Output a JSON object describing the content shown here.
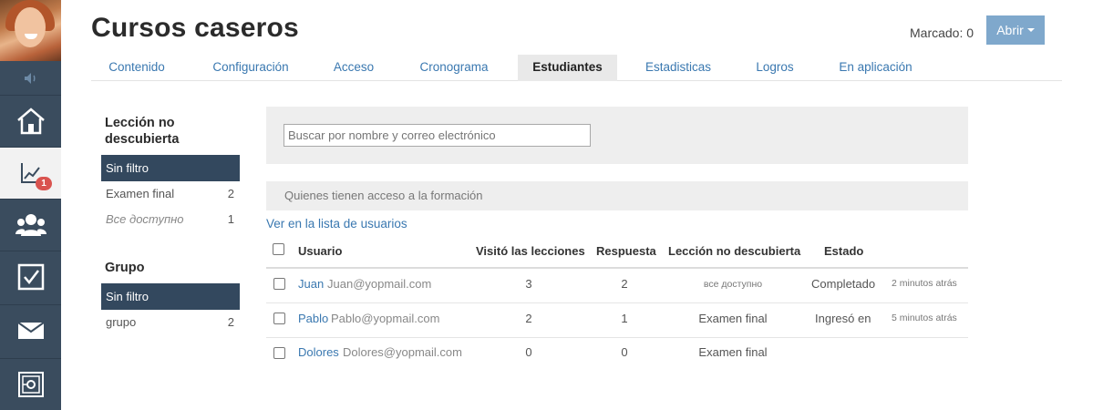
{
  "sidebar": {
    "badge_count": "1",
    "items": [
      {
        "name": "home-icon"
      },
      {
        "name": "chart-icon"
      },
      {
        "name": "users-icon"
      },
      {
        "name": "checkbox-icon"
      },
      {
        "name": "mail-icon"
      },
      {
        "name": "settings-icon"
      }
    ]
  },
  "header": {
    "title": "Cursos caseros",
    "marked_label": "Marcado: 0",
    "open_button": "Abrir"
  },
  "tabs": [
    {
      "label": "Contenido"
    },
    {
      "label": "Configuración"
    },
    {
      "label": "Acceso"
    },
    {
      "label": "Cronograma"
    },
    {
      "label": "Estudiantes"
    },
    {
      "label": "Estadisticas"
    },
    {
      "label": "Logros"
    },
    {
      "label": "En aplicación"
    }
  ],
  "filters": {
    "lesson_heading": "Lección no descubierta",
    "lesson_items": [
      {
        "label": "Sin filtro",
        "count": ""
      },
      {
        "label": "Examen final",
        "count": "2"
      },
      {
        "label": "Все доступно",
        "count": "1"
      }
    ],
    "group_heading": "Grupo",
    "group_items": [
      {
        "label": "Sin filtro",
        "count": ""
      },
      {
        "label": "grupo",
        "count": "2"
      }
    ]
  },
  "search": {
    "placeholder": "Buscar por nombre y correo electrónico"
  },
  "access_bar": "Quienes tienen acceso a la formación",
  "user_list_link": "Ver en la lista de usuarios",
  "table": {
    "headers": {
      "user": "Usuario",
      "visited": "Visitó las lecciones",
      "answers": "Respuesta",
      "lesson": "Lección no descubierta",
      "status": "Estado"
    },
    "rows": [
      {
        "name": "Juan",
        "email": "Juan@yopmail.com",
        "visited": "3",
        "answers": "2",
        "lesson": "все доступно",
        "status": "Completado",
        "time": "2 minutos atrás"
      },
      {
        "name": "Pablo",
        "email": "Pablo@yopmail.com",
        "visited": "2",
        "answers": "1",
        "lesson": "Examen final",
        "status": "Ingresó en",
        "time": "5 minutos atrás"
      },
      {
        "name": "Dolores",
        "email": "Dolores@yopmail.com",
        "visited": "0",
        "answers": "0",
        "lesson": "Examen final",
        "status": "",
        "time": ""
      }
    ]
  }
}
